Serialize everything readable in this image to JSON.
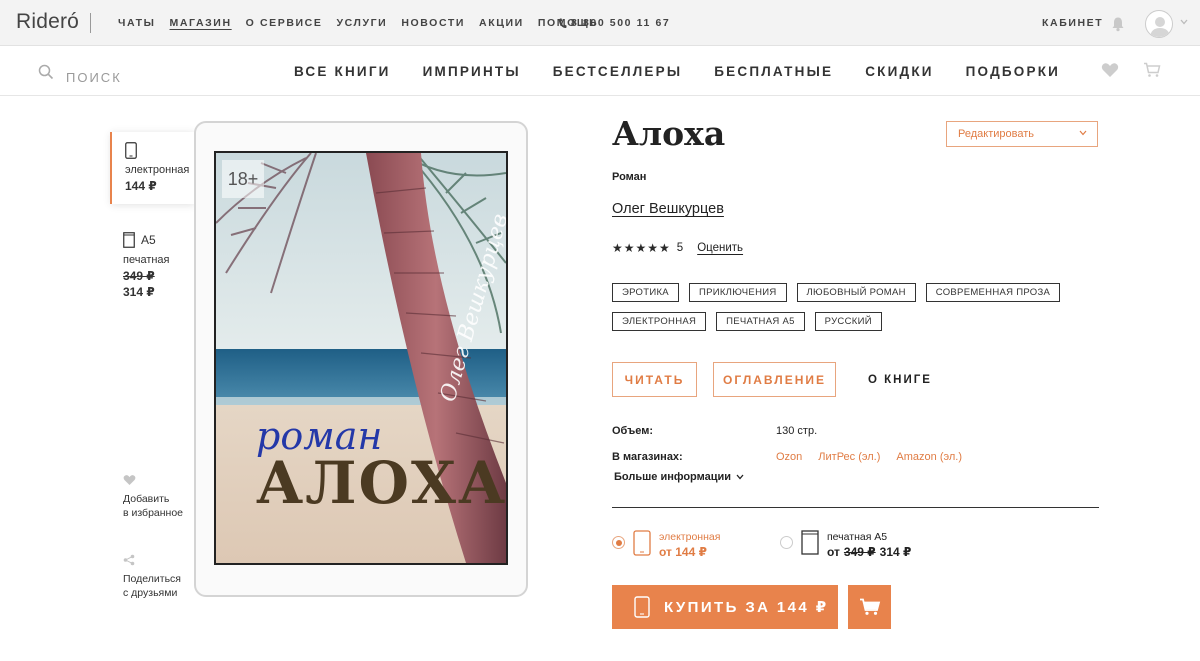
{
  "topbar": {
    "logo": "Rideró",
    "nav": [
      "ЧАТЫ",
      "МАГАЗИН",
      "О СЕРВИСЕ",
      "УСЛУГИ",
      "НОВОСТИ",
      "АКЦИИ",
      "ПОМОЩЬ"
    ],
    "active_nav": "МАГАЗИН",
    "phone": "8 800 500 11 67",
    "cabinet": "КАБИНЕТ"
  },
  "navbar": {
    "search_placeholder": "ПОИСК",
    "items": [
      "ВСЕ КНИГИ",
      "ИМПРИНТЫ",
      "БЕСТСЕЛЛЕРЫ",
      "БЕСПЛАТНЫЕ",
      "СКИДКИ",
      "ПОДБОРКИ"
    ]
  },
  "formats": {
    "ebook": {
      "label": "электронная",
      "price": "144 ₽"
    },
    "print": {
      "size": "A5",
      "label": "печатная",
      "old_price": "349 ₽",
      "price": "314 ₽"
    }
  },
  "side_actions": {
    "favorite": [
      "Добавить",
      "в избранное"
    ],
    "share": [
      "Поделиться",
      "с друзьями"
    ]
  },
  "cover": {
    "age": "18+",
    "subtitle": "роман",
    "title": "АЛОХА",
    "author": "Олег Вешкурцев"
  },
  "book": {
    "title": "Алоха",
    "genre": "Роман",
    "author": "Олег Вешкурцев",
    "rating_stars": "★★★★★",
    "rating_count": "5",
    "rate_link": "Оценить",
    "edit_label": "Редактировать",
    "tags": [
      "ЭРОТИКА",
      "ПРИКЛЮЧЕНИЯ",
      "ЛЮБОВНЫЙ РОМАН",
      "СОВРЕМЕННАЯ ПРОЗА",
      "ЭЛЕКТРОННАЯ",
      "ПЕЧАТНАЯ A5",
      "РУССКИЙ"
    ]
  },
  "actions": {
    "read": "ЧИТАТЬ",
    "toc": "ОГЛАВЛЕНИЕ",
    "about": "О КНИГЕ"
  },
  "details": {
    "volume_label": "Объем:",
    "volume_value": "130 стр.",
    "stores_label": "В магазинах:",
    "stores": [
      "Ozon",
      "ЛитРес (эл.)",
      "Amazon (эл.)"
    ],
    "more_info": "Больше информации"
  },
  "purchase": {
    "ebook_label": "электронная",
    "ebook_price": "от 144 ₽",
    "print_label": "печатная A5",
    "print_from": "от",
    "print_old_price": "349 ₽",
    "print_price": "314 ₽",
    "buy_label": "КУПИТЬ ЗА 144 ₽"
  },
  "colors": {
    "accent": "#e8834c",
    "accent_text": "#e07c44",
    "text": "#222222"
  }
}
